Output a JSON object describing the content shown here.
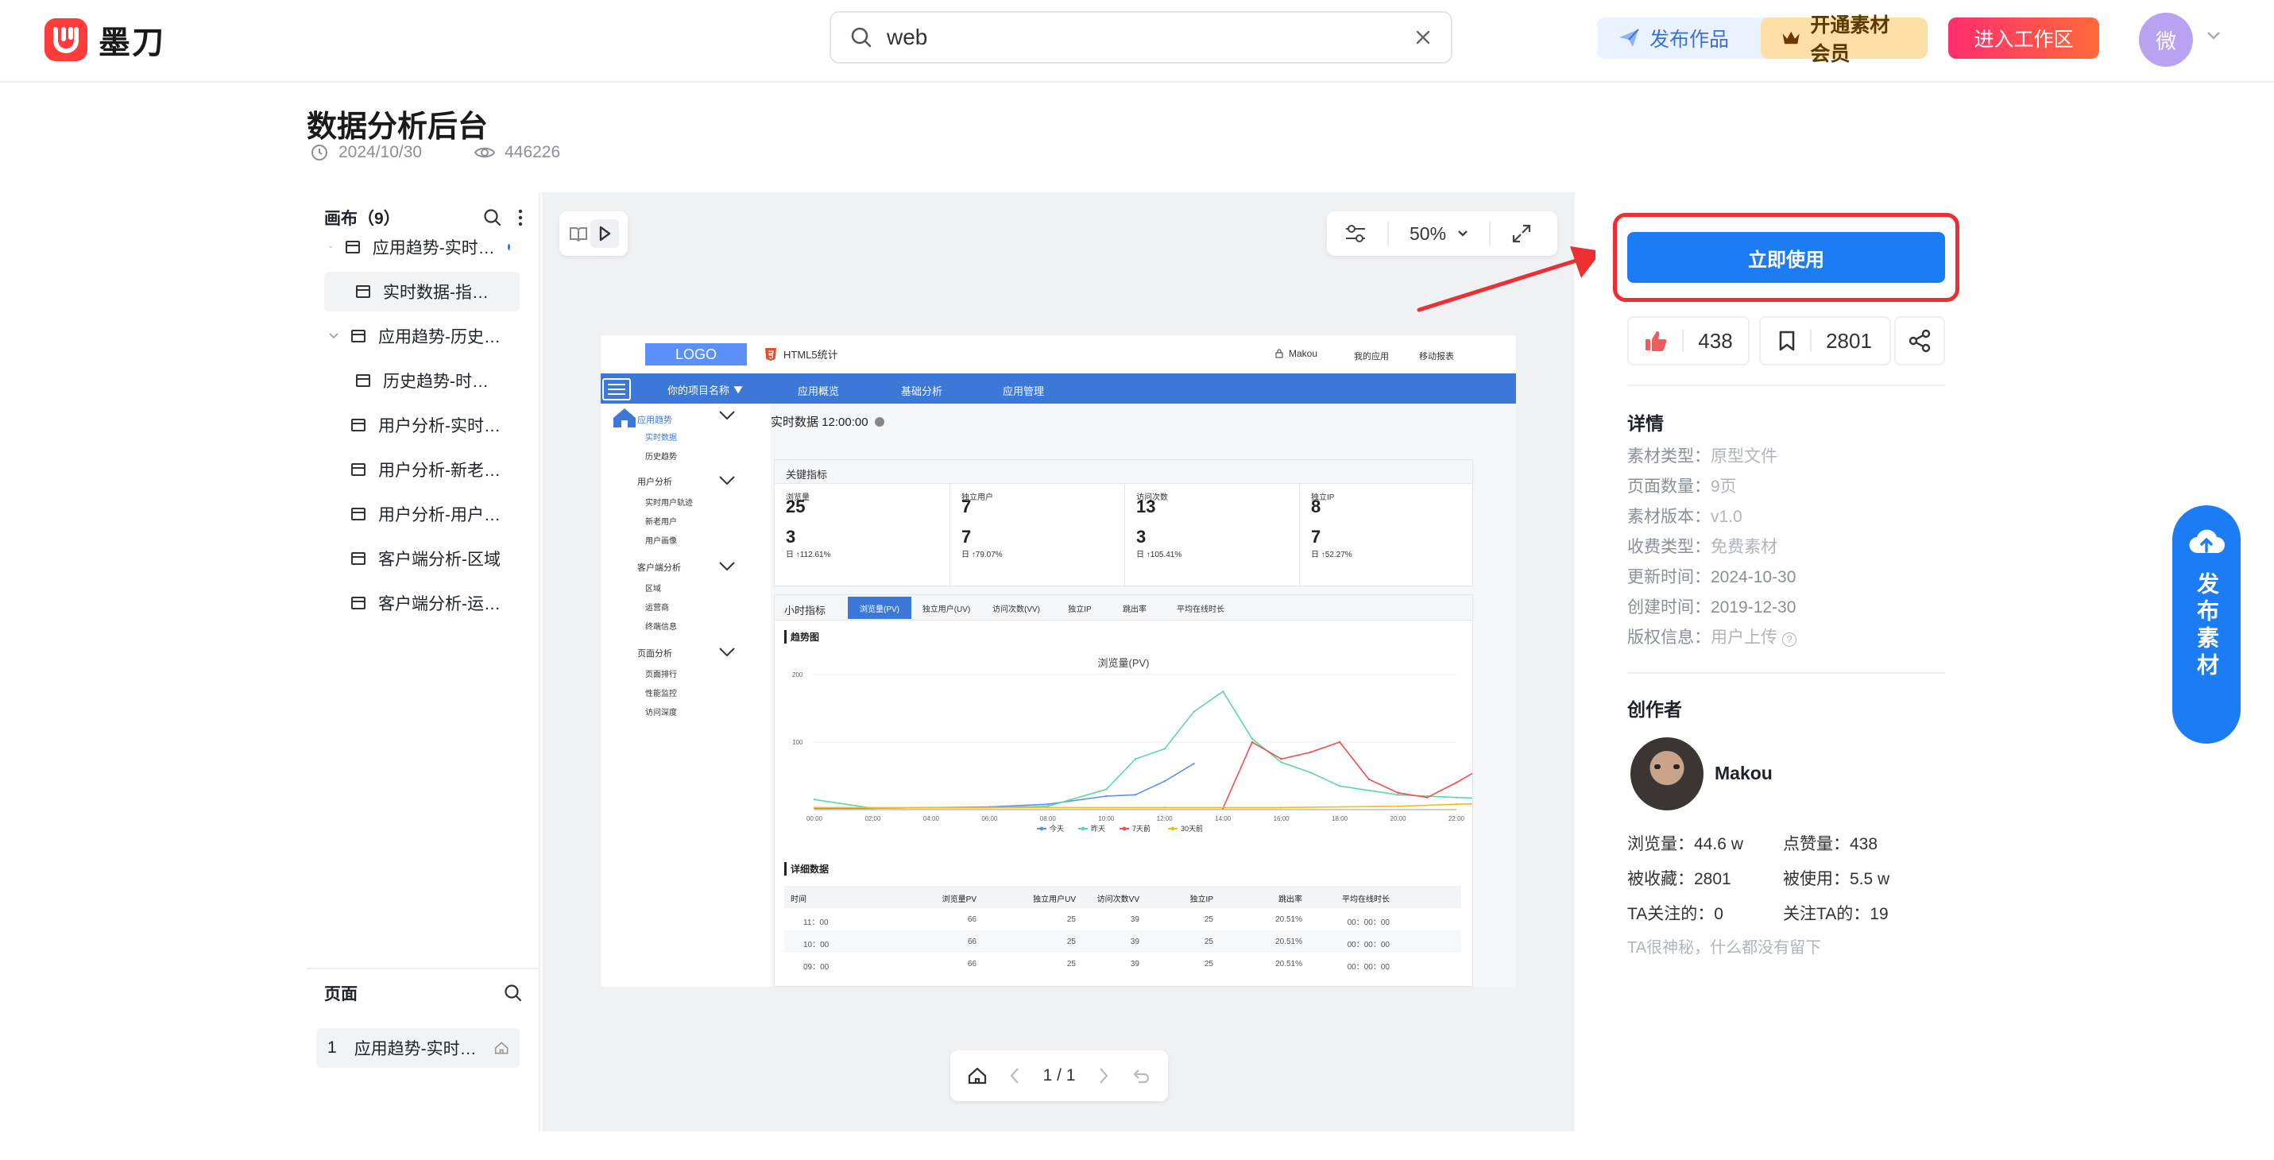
{
  "app": {
    "name": "墨刀",
    "search_value": "web",
    "publish_label": "发布作品",
    "vip_label": "开通素材会员",
    "workspace_label": "进入工作区",
    "avatar_text": "微"
  },
  "work": {
    "title": "数据分析后台",
    "date": "2024/10/30",
    "views": "446226"
  },
  "canvas_panel": {
    "title": "画布（9）",
    "items": [
      {
        "label": "应用趋势-实时…",
        "level": 0,
        "expanded": true,
        "dot": true
      },
      {
        "label": "实时数据-指…",
        "level": 1,
        "selected": true
      },
      {
        "label": "应用趋势-历史…",
        "level": 0,
        "expanded": true
      },
      {
        "label": "历史趋势-时…",
        "level": 1
      },
      {
        "label": "用户分析-实时…",
        "level": 0
      },
      {
        "label": "用户分析-新老…",
        "level": 0
      },
      {
        "label": "用户分析-用户…",
        "level": 0
      },
      {
        "label": "客户端分析-区域",
        "level": 0
      },
      {
        "label": "客户端分析-运…",
        "level": 0
      }
    ]
  },
  "pages_panel": {
    "title": "页面",
    "items": [
      {
        "num": "1",
        "label": "应用趋势-实时…"
      }
    ]
  },
  "viewer": {
    "zoom": "50%",
    "page_indicator": "1 / 1"
  },
  "mockup": {
    "logo": "LOGO",
    "brand": "HTML5统计",
    "user": "Makou",
    "nav_right": [
      "我的应用",
      "移动报表"
    ],
    "navbar": [
      "你的项目名称",
      "应用概览",
      "基础分析",
      "应用管理"
    ],
    "sidebar": [
      {
        "group": "应用趋势",
        "items": [
          "实时数据",
          "历史趋势"
        ]
      },
      {
        "group": "用户分析",
        "items": [
          "实时用户轨迹",
          "新老用户",
          "用户画像"
        ]
      },
      {
        "group": "客户端分析",
        "items": [
          "区域",
          "运营商",
          "终端信息"
        ]
      },
      {
        "group": "页面分析",
        "items": [
          "页面排行",
          "性能监控",
          "访问深度"
        ]
      }
    ],
    "realtime": "实时数据 12:00:00",
    "key_metrics_title": "关键指标",
    "metrics": [
      {
        "label": "浏览量",
        "big1": "25",
        "big2": "3",
        "change": "日 ↑112.61%"
      },
      {
        "label": "独立用户",
        "big1": "7",
        "big2": "7",
        "change": "日 ↑79.07%"
      },
      {
        "label": "访问次数",
        "big1": "13",
        "big2": "3",
        "change": "日 ↑105.41%"
      },
      {
        "label": "独立IP",
        "big1": "8",
        "big2": "7",
        "change": "日 ↑52.27%"
      }
    ],
    "hour_title": "小时指标",
    "tabs": [
      "浏览量(PV)",
      "独立用户(UV)",
      "访问次数(VV)",
      "独立IP",
      "跳出率",
      "平均在线时长"
    ],
    "trend_title": "趋势图",
    "detail_title": "详细数据",
    "table": {
      "headers": [
        "时间",
        "浏览量PV",
        "独立用户UV",
        "访问次数VV",
        "独立IP",
        "跳出率",
        "平均在线时长"
      ],
      "rows": [
        [
          "11：00",
          "66",
          "25",
          "39",
          "25",
          "20.51%",
          "00：00：00"
        ],
        [
          "10：00",
          "66",
          "25",
          "39",
          "25",
          "20.51%",
          "00：00：00"
        ],
        [
          "09：00",
          "66",
          "25",
          "39",
          "25",
          "20.51%",
          "00：00：00"
        ]
      ]
    }
  },
  "chart_data": {
    "type": "line",
    "title": "浏览量(PV)",
    "x": [
      "00:00",
      "02:00",
      "04:00",
      "06:00",
      "08:00",
      "10:00",
      "12:00",
      "14:00",
      "16:00",
      "18:00",
      "20:00",
      "22:00"
    ],
    "ylim": [
      0,
      200
    ],
    "yticks": [
      100,
      200
    ],
    "series": [
      {
        "name": "今天",
        "color": "#5b8ff9",
        "points": [
          [
            0,
            2
          ],
          [
            1,
            2
          ],
          [
            2,
            3
          ],
          [
            3,
            4
          ],
          [
            4,
            8
          ],
          [
            5,
            20
          ],
          [
            5.5,
            22
          ],
          [
            6,
            42
          ],
          [
            6.5,
            68
          ]
        ]
      },
      {
        "name": "昨天",
        "color": "#5ad8a6",
        "points": [
          [
            0,
            15
          ],
          [
            1,
            2
          ],
          [
            2,
            3
          ],
          [
            3,
            3
          ],
          [
            4,
            5
          ],
          [
            5,
            30
          ],
          [
            5.5,
            75
          ],
          [
            6,
            90
          ],
          [
            6.5,
            145
          ],
          [
            7,
            175
          ],
          [
            7.5,
            105
          ],
          [
            8,
            70
          ],
          [
            8.5,
            55
          ],
          [
            9,
            35
          ],
          [
            10,
            22
          ],
          [
            11,
            18
          ],
          [
            12,
            15
          ],
          [
            12.5,
            55
          ],
          [
            13,
            40
          ],
          [
            13.5,
            60
          ]
        ]
      },
      {
        "name": "7天前",
        "color": "#f64e4e",
        "points": [
          [
            7,
            2
          ],
          [
            7.5,
            100
          ],
          [
            8,
            75
          ],
          [
            8.5,
            85
          ],
          [
            9,
            100
          ],
          [
            9.5,
            45
          ],
          [
            10,
            25
          ],
          [
            10.5,
            18
          ],
          [
            11,
            40
          ],
          [
            11.5,
            65
          ],
          [
            12,
            62
          ]
        ]
      },
      {
        "name": "30天前",
        "color": "#f6bd16",
        "points": [
          [
            0,
            3
          ],
          [
            2,
            3
          ],
          [
            4,
            3
          ],
          [
            6,
            3
          ],
          [
            8,
            3
          ],
          [
            10,
            5
          ],
          [
            11,
            8
          ],
          [
            12,
            10
          ]
        ]
      }
    ]
  },
  "details": {
    "title": "详情",
    "rows": [
      {
        "label": "素材类型：",
        "value": "原型文件"
      },
      {
        "label": "页面数量：",
        "value": "9页"
      },
      {
        "label": "素材版本：",
        "value": "v1.0"
      },
      {
        "label": "收费类型：",
        "value": "免费素材"
      },
      {
        "label": "更新时间：",
        "value": "2024-10-30",
        "dark": true
      },
      {
        "label": "创建时间：",
        "value": "2019-12-30",
        "dark": true
      },
      {
        "label": "版权信息：",
        "value": "用户上传"
      }
    ]
  },
  "actions": {
    "use_label": "立即使用",
    "likes": "438",
    "favorites": "2801"
  },
  "creator": {
    "title": "创作者",
    "name": "Makou",
    "stats": [
      {
        "label": "浏览量：",
        "value": "44.6 w"
      },
      {
        "label": "点赞量：",
        "value": "438"
      },
      {
        "label": "被收藏：",
        "value": "2801"
      },
      {
        "label": "被使用：",
        "value": "5.5 w"
      },
      {
        "label": "TA关注的：",
        "value": "0"
      },
      {
        "label": "关注TA的：",
        "value": "19"
      }
    ],
    "bio": "TA很神秘，什么都没有留下"
  },
  "float": {
    "label": "发布素材"
  },
  "colors": {
    "primary": "#1c7cf4",
    "highlight": "#ec2f33",
    "mock_nav": "#3c78d8"
  }
}
